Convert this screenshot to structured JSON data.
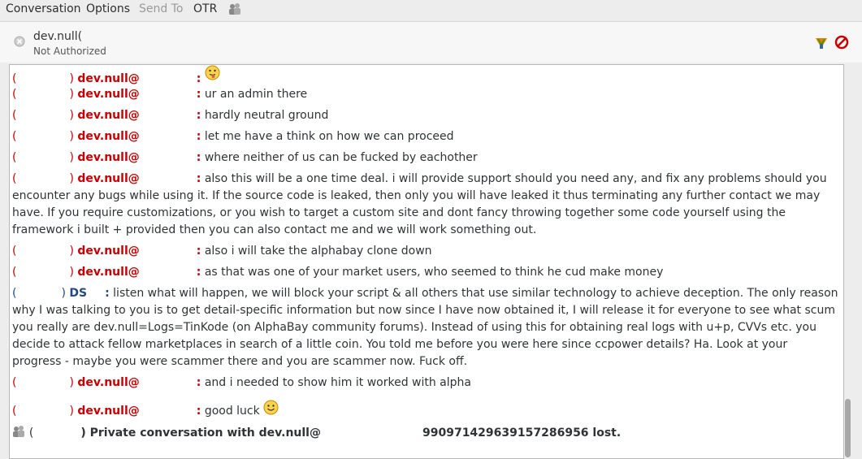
{
  "menubar": {
    "items": [
      {
        "label": "Conversation",
        "enabled": true
      },
      {
        "label": "Options",
        "enabled": true
      },
      {
        "label": "Send To",
        "enabled": false
      },
      {
        "label": "OTR",
        "enabled": true
      }
    ],
    "icon": "people-icon"
  },
  "header": {
    "buddy_name": "dev.null(",
    "status": "Not Authorized"
  },
  "messages": [
    {
      "paren": "(",
      "paren_close": ")",
      "nick": "dev.null@",
      "colon": ":",
      "text": "",
      "emoticon": "tongue-smiley-icon"
    },
    {
      "paren": "(",
      "paren_close": ")",
      "nick": "dev.null@",
      "colon": ":",
      "text": "ur an admin there"
    },
    {
      "paren": "(",
      "paren_close": ")",
      "nick": "dev.null@",
      "colon": ":",
      "text": "hardly neutral ground"
    },
    {
      "paren": "(",
      "paren_close": ")",
      "nick": "dev.null@",
      "colon": ":",
      "text": "let me have a think on how we can proceed"
    },
    {
      "paren": "(",
      "paren_close": ")",
      "nick": "dev.null@",
      "colon": ":",
      "text": "where neither of us can be fucked by eachother"
    },
    {
      "paren": "(",
      "paren_close": ")",
      "nick": "dev.null@",
      "colon": ":",
      "text": "also this will be a one time deal. i will provide support should you need any, and fix any problems should you encounter any bugs while using it. If the source code is leaked, then only you will have leaked it thus terminating any further contact we may have. If you require customizations, or you wish to target a custom site and dont fancy throwing together some code yourself using the framework i built + provided then you can also contact me and we will work something out."
    },
    {
      "paren": "(",
      "paren_close": ")",
      "nick": "dev.null@",
      "colon": ":",
      "text": "also i will take the alphabay clone down"
    },
    {
      "paren": "(",
      "paren_close": ")",
      "nick": "dev.null@",
      "colon": ":",
      "text": "as that was one of your market users, who seemed to think he cud make money"
    },
    {
      "paren": "(",
      "paren_close": ")",
      "nick": "DS",
      "colon": ":",
      "text": "listen what will happen, we will block your script & all others that use similar technology to achieve deception. The only reason why I was talking to you is to get detail-specific information but now since I have now obtained it, I will release it for everyone to see what scum you really are dev.null=Logs=TinKode (on AlphaBay community forums). Instead of using this for obtaining real logs with u+p, CVVs etc. you decide to attack fellow marketplaces in search of a little coin. You told me before you were here since ccpower details? Ha. Look at your progress - maybe you were scammer there and you are scammer now. Fuck off."
    },
    {
      "paren": "(",
      "paren_close": ")",
      "nick": "dev.null@",
      "colon": ":",
      "text": "and i needed to show him it worked with alpha"
    },
    {
      "paren": "(",
      "paren_close": ")",
      "nick": "dev.null@",
      "colon": ":",
      "text": "good luck",
      "emoticon": "smile-smiley-icon"
    }
  ],
  "system_message": {
    "paren": "(",
    "paren_close": ")",
    "text": "Private conversation with dev.null@",
    "fingerprint": "99097142963915728695​6 lost."
  },
  "colors": {
    "self": "#cc0000",
    "other": "#204a87"
  }
}
